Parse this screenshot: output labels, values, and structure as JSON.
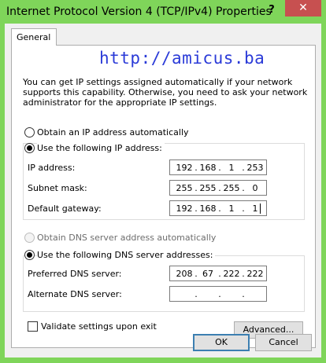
{
  "window": {
    "title": "Internet Protocol Version 4 (TCP/IPv4) Properties",
    "help_label": "?",
    "close_label": "✕"
  },
  "tabs": [
    {
      "label": "General",
      "active": true
    }
  ],
  "watermark": "http://amicus.ba",
  "description": "You can get IP settings assigned automatically if your network supports this capability. Otherwise, you need to ask your network administrator for the appropriate IP settings.",
  "ip": {
    "auto_label": "Obtain an IP address automatically",
    "auto_selected": false,
    "manual_label": "Use the following IP address:",
    "manual_selected": true,
    "fields": [
      {
        "label": "IP address:",
        "octets": [
          "192",
          "168",
          "1",
          "253"
        ]
      },
      {
        "label": "Subnet mask:",
        "octets": [
          "255",
          "255",
          "255",
          "0"
        ]
      },
      {
        "label": "Default gateway:",
        "octets": [
          "192",
          "168",
          "1",
          "1"
        ]
      }
    ]
  },
  "dns": {
    "auto_label": "Obtain DNS server address automatically",
    "auto_selected": false,
    "auto_disabled": true,
    "manual_label": "Use the following DNS server addresses:",
    "manual_selected": true,
    "fields": [
      {
        "label": "Preferred DNS server:",
        "octets": [
          "208",
          "67",
          "222",
          "222"
        ]
      },
      {
        "label": "Alternate DNS server:",
        "octets": [
          "",
          "",
          "",
          ""
        ]
      }
    ]
  },
  "validate": {
    "label": "Validate settings upon exit",
    "checked": false
  },
  "buttons": {
    "advanced": "Advanced...",
    "ok": "OK",
    "cancel": "Cancel"
  },
  "dot": "."
}
